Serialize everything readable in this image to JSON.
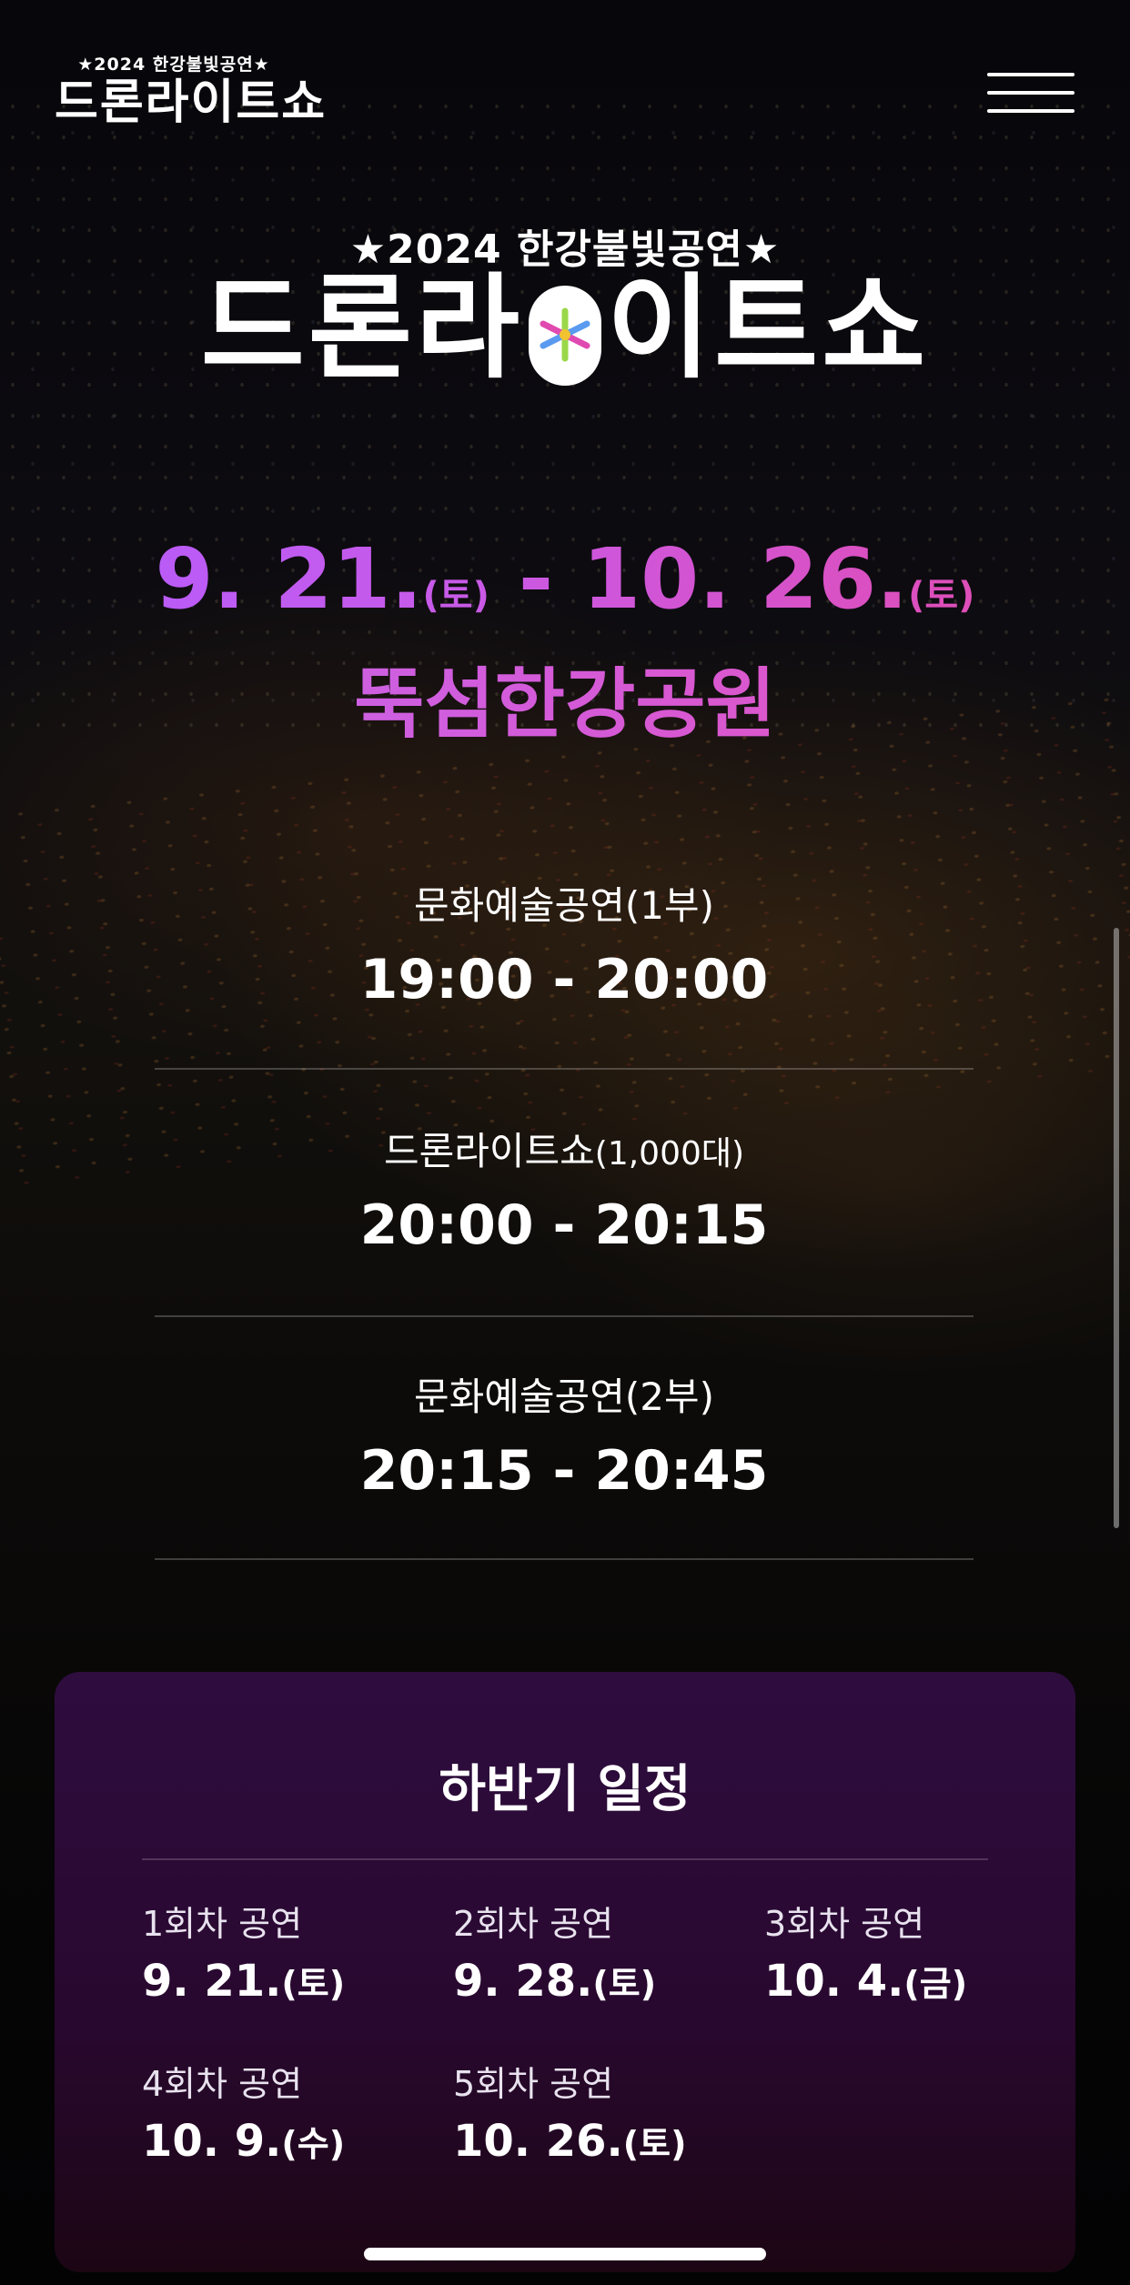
{
  "header": {
    "logo_sub": "★2024 한강불빛공연★",
    "logo_main_a": "드론라",
    "logo_main_b": "이트쇼"
  },
  "hero": {
    "subtitle": "★2024 한강불빛공연★",
    "title_a": "드론라",
    "title_b": "이트쇼",
    "start_date": "9. 21.",
    "start_dow": "(토)",
    "range_sep": " - ",
    "end_date": "10. 26.",
    "end_dow": "(토)",
    "place": "뚝섬한강공원"
  },
  "program": [
    {
      "name": "문화예술공연(1부)",
      "name_small": "",
      "time": "19:00 - 20:00"
    },
    {
      "name": "드론라이트쇼",
      "name_small": "(1,000대)",
      "time": "20:00 - 20:15"
    },
    {
      "name": "문화예술공연(2부)",
      "name_small": "",
      "time": "20:15 - 20:45"
    }
  ],
  "schedule": {
    "title": "하반기 일정",
    "items": [
      {
        "label": "1회차 공연",
        "date": "9. 21.",
        "dow": "(토)"
      },
      {
        "label": "2회차 공연",
        "date": "9. 28.",
        "dow": "(토)"
      },
      {
        "label": "3회차 공연",
        "date": "10. 4.",
        "dow": "(금)"
      },
      {
        "label": "4회차 공연",
        "date": "10. 9.",
        "dow": "(수)"
      },
      {
        "label": "5회차 공연",
        "date": "10. 26.",
        "dow": "(토)"
      }
    ]
  },
  "colors": {
    "accent_purple": "#b35cff",
    "accent_pink": "#e54aaa",
    "card_bg": "#2e0d3f"
  },
  "icons": {
    "menu": "hamburger-menu-icon",
    "logo_mark": "star-burst-icon"
  }
}
